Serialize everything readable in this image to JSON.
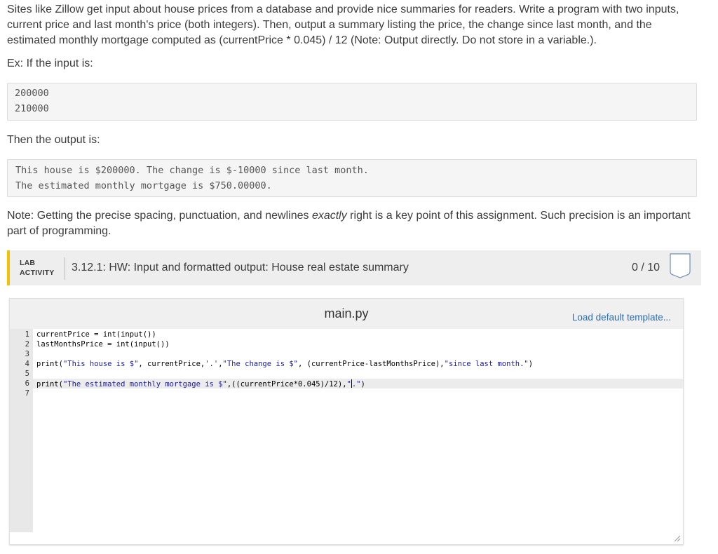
{
  "description": {
    "p1": "Sites like Zillow get input about house prices from a database and provide nice summaries for readers. Write a program with two inputs, current price and last month's price (both integers). Then, output a summary listing the price, the change since last month, and the estimated monthly mortgage computed as (currentPrice * 0.045) / 12 (Note: Output directly. Do not store in a variable.).",
    "p2": "Ex: If the input is:",
    "input_lines": [
      "200000",
      "210000"
    ],
    "p3": "Then the output is:",
    "output_lines": [
      "This house is $200000. The change is $-10000 since last month.",
      "The estimated monthly mortgage is $750.00000."
    ],
    "p4_before": "Note: Getting the precise spacing, punctuation, and newlines ",
    "p4_em": "exactly",
    "p4_after": " right is a key point of this assignment. Such precision is an important part of programming."
  },
  "lab": {
    "tag_line1": "LAB",
    "tag_line2": "ACTIVITY",
    "title": "3.12.1: HW: Input and formatted output: House real estate summary",
    "score": "0 / 10",
    "shield_icon": "shield-icon"
  },
  "editor": {
    "filename": "main.py",
    "load_default": "Load default template...",
    "line_numbers": [
      "1",
      "2",
      "3",
      "4",
      "5",
      "6",
      "7"
    ],
    "code": {
      "l1": "currentPrice = int(input())",
      "l2": "lastMonthsPrice = int(input())",
      "l4a": "print(",
      "l4s1": "\"This house is $\"",
      "l4b": ", currentPrice,",
      "l4s2": "'.'",
      "l4c": ",",
      "l4s3": "\"The change is $\"",
      "l4d": ", (currentPrice-lastMonthsPrice),",
      "l4s4": "\"since last month.\"",
      "l4e": ")",
      "l6a": "print(",
      "l6s1": "\"The estimated monthly mortgage is $\"",
      "l6b": ",((currentPrice*0.045)/12),",
      "l6s2a": "\"",
      "l6s2b": ".\"",
      "l6c": ")"
    },
    "colors": {
      "string": "#1a1aa6",
      "link": "#2a6db2",
      "lab_accent": "#f2c200"
    }
  }
}
